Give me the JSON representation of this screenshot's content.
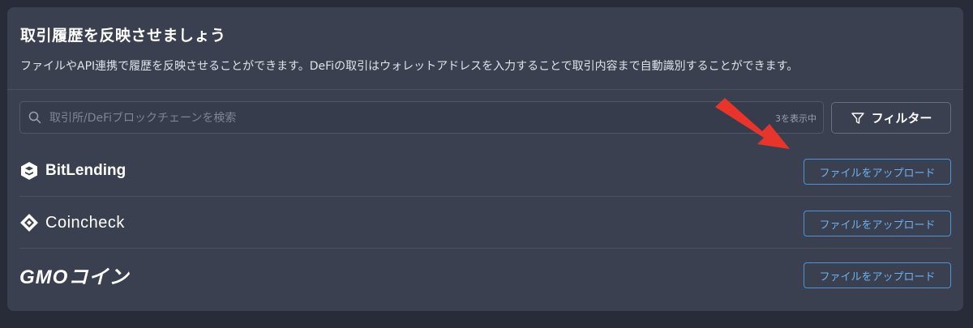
{
  "header": {
    "title": "取引履歴を反映させましょう",
    "description": "ファイルやAPI連携で履歴を反映させることができます。DeFiの取引はウォレットアドレスを入力することで取引内容まで自動識別することができます。"
  },
  "search": {
    "placeholder": "取引所/DeFiブロックチェーンを検索",
    "value": "",
    "count_text": "3を表示中"
  },
  "filter": {
    "label": "フィルター"
  },
  "exchanges": [
    {
      "name": "BitLending",
      "upload_label": "ファイルをアップロード"
    },
    {
      "name": "Coincheck",
      "upload_label": "ファイルをアップロード"
    },
    {
      "name": "GMOコイン",
      "upload_label": "ファイルをアップロード"
    }
  ],
  "colors": {
    "background": "#272c38",
    "panel": "#3a4050",
    "accent": "#6eb0f0",
    "annotation_arrow": "#e8352b"
  }
}
